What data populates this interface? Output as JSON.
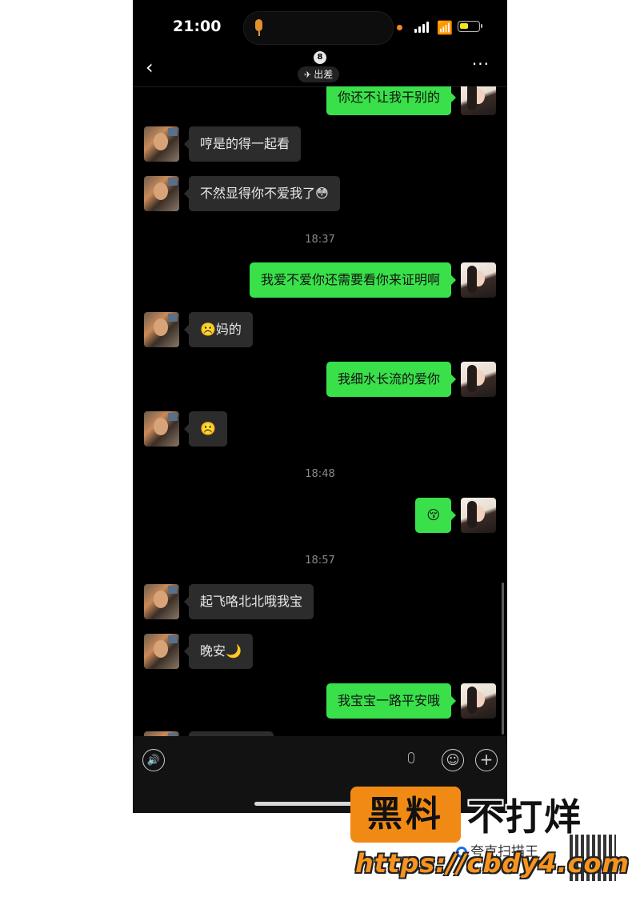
{
  "status_bar": {
    "time": "21:00"
  },
  "nav": {
    "badge": "8",
    "tag": "出差",
    "back": "‹",
    "more": "···"
  },
  "messages": [
    {
      "side": "out",
      "text": "你还不让我干别的"
    },
    {
      "side": "in",
      "text": "哼是的得一起看"
    },
    {
      "side": "in",
      "text": "不然显得你不爱我了😳"
    },
    {
      "timestamp": "18:37"
    },
    {
      "side": "out",
      "text": "我爱不爱你还需要看你来证明啊"
    },
    {
      "side": "in",
      "text": "☹️妈的"
    },
    {
      "side": "out",
      "text": "我细水长流的爱你"
    },
    {
      "side": "in",
      "text": "☹️"
    },
    {
      "timestamp": "18:48"
    },
    {
      "side": "out",
      "text": "😚"
    },
    {
      "timestamp": "18:57"
    },
    {
      "side": "in",
      "text": "起飞咯北北哦我宝"
    },
    {
      "side": "in",
      "text": "晚安🌙"
    },
    {
      "side": "out",
      "text": "我宝宝一路平安哦"
    }
  ],
  "watermark": {
    "brand": "黑料",
    "slogan": "不打烊",
    "scanner": "夸克扫描王",
    "url": "https://cbdy4.com"
  },
  "colors": {
    "outgoing_bubble": "#3ae04a",
    "incoming_bubble": "#2c2c2c",
    "background": "#000000",
    "watermark_orange": "#f18a14"
  }
}
